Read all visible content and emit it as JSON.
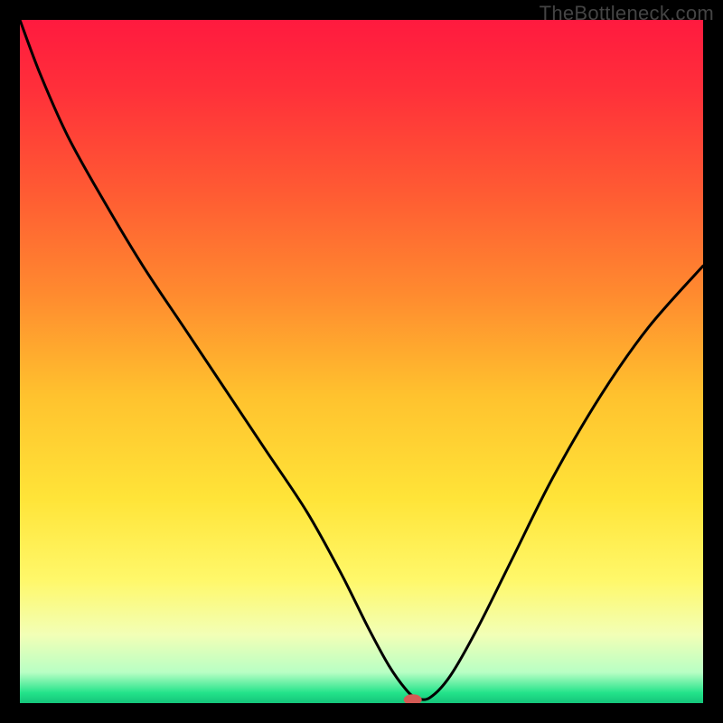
{
  "watermark": "TheBottleneck.com",
  "chart_data": {
    "type": "line",
    "title": "",
    "xlabel": "",
    "ylabel": "",
    "xlim": [
      0,
      100
    ],
    "ylim": [
      0,
      100
    ],
    "grid": false,
    "background_gradient": {
      "stops": [
        {
          "pos": 0.0,
          "color": "#ff1a3f"
        },
        {
          "pos": 0.1,
          "color": "#ff2f3a"
        },
        {
          "pos": 0.25,
          "color": "#ff5a33"
        },
        {
          "pos": 0.4,
          "color": "#ff8a2f"
        },
        {
          "pos": 0.55,
          "color": "#ffc22e"
        },
        {
          "pos": 0.7,
          "color": "#ffe438"
        },
        {
          "pos": 0.82,
          "color": "#fff86a"
        },
        {
          "pos": 0.9,
          "color": "#f2ffb6"
        },
        {
          "pos": 0.955,
          "color": "#b8ffc4"
        },
        {
          "pos": 0.985,
          "color": "#23e38a"
        },
        {
          "pos": 1.0,
          "color": "#15c47a"
        }
      ]
    },
    "series": [
      {
        "name": "bottleneck-curve",
        "x": [
          0,
          3,
          7,
          12,
          18,
          24,
          30,
          36,
          42,
          47,
          51,
          54,
          56.5,
          58,
          60,
          63,
          67,
          72,
          78,
          85,
          92,
          100
        ],
        "y": [
          100,
          92,
          83,
          74,
          64,
          55,
          46,
          37,
          28,
          19,
          11,
          5.5,
          2,
          0.8,
          0.8,
          4,
          11,
          21,
          33,
          45,
          55,
          64
        ]
      }
    ],
    "marker": {
      "name": "min-point",
      "x": 57.5,
      "y": 0.5,
      "color": "#d45a55",
      "rx": 10,
      "ry": 6
    }
  }
}
